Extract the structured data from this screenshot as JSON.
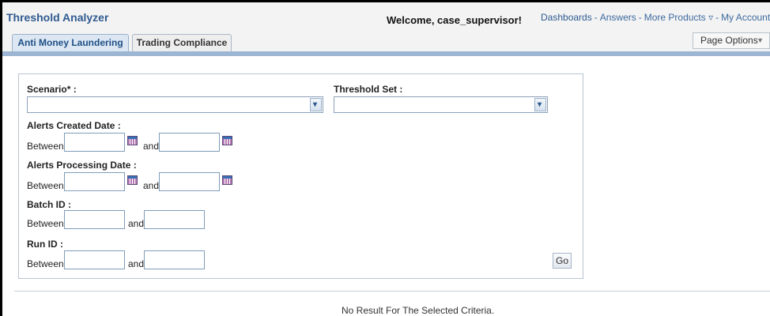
{
  "app": {
    "title": "Threshold Analyzer",
    "welcome": "Welcome, case_supervisor!"
  },
  "global_nav": {
    "dashboards": "Dashboards",
    "answers": "Answers",
    "more_products": "More Products",
    "my_account": "My Account",
    "separator": "-",
    "more_arrow": "▿"
  },
  "tabs": [
    {
      "label": "Anti Money Laundering",
      "active": true
    },
    {
      "label": "Trading Compliance",
      "active": false
    }
  ],
  "page_options": {
    "label": "Page Options",
    "arrow": "▼"
  },
  "form": {
    "scenario_label": "Scenario* :",
    "scenario_value": "",
    "threshold_set_label": "Threshold Set :",
    "threshold_set_value": "",
    "alerts_created_label": "Alerts Created Date :",
    "alerts_processing_label": "Alerts Processing Date :",
    "batch_id_label": "Batch ID :",
    "run_id_label": "Run ID :",
    "between": "Between",
    "and": "and",
    "dropdown_arrow": "▾",
    "go_label": "Go"
  },
  "results": {
    "message": "No Result For The Selected Criteria."
  },
  "colors": {
    "title_blue": "#2f5a90",
    "nav_blue": "#3d6a9f",
    "bar_blue": "#9cb5d3",
    "active_tab_bg": "#dce7f3"
  },
  "icons": {
    "calendar": "calendar-icon",
    "dropdown": "chevron-down-icon"
  }
}
